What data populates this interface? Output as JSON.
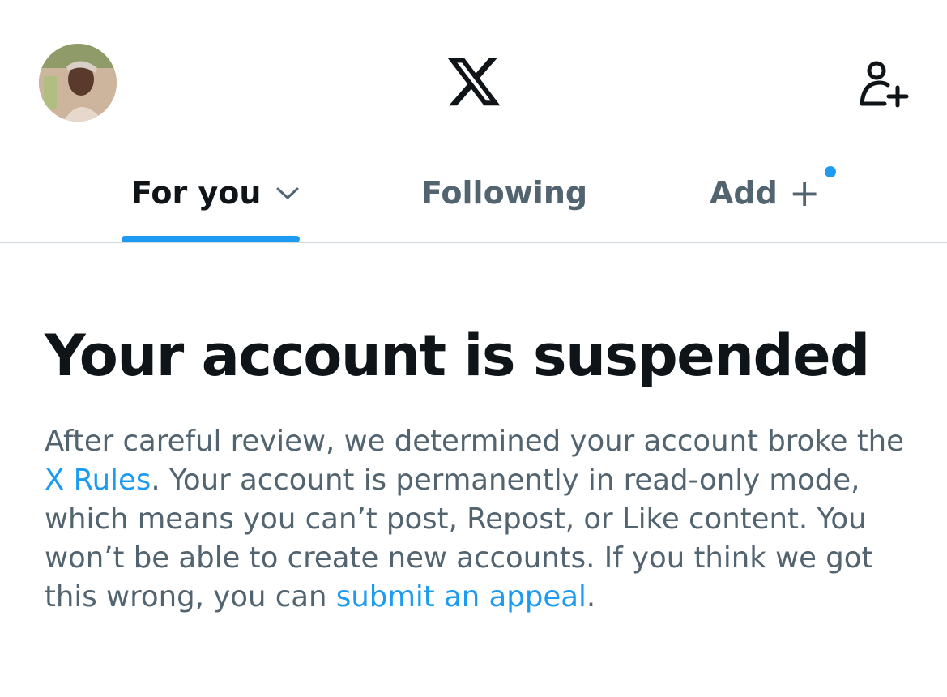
{
  "header": {
    "avatar_icon": "profile-avatar",
    "logo_icon": "x-logo-icon",
    "follow_icon": "add-person-icon"
  },
  "tabs": {
    "for_you_label": "For you",
    "following_label": "Following",
    "add_label": "Add",
    "add_symbol": "+",
    "chevron_icon": "chevron-down-icon",
    "active": "For you"
  },
  "colors": {
    "accent": "#1d9bf0",
    "primary_text": "#0f1419",
    "secondary_text": "#536471",
    "divider": "#cfd9de"
  },
  "content": {
    "title": "Your account is suspended",
    "body_part1": "After careful review, we determined your account broke the ",
    "link_rules": "X Rules",
    "body_part2": ". Your account is permanently in read-only mode, which means you can’t post, Repost, or Like content. You won’t be able to create new accounts. If you think we got this wrong, you can ",
    "link_appeal": "submit an appeal",
    "body_part3": "."
  }
}
